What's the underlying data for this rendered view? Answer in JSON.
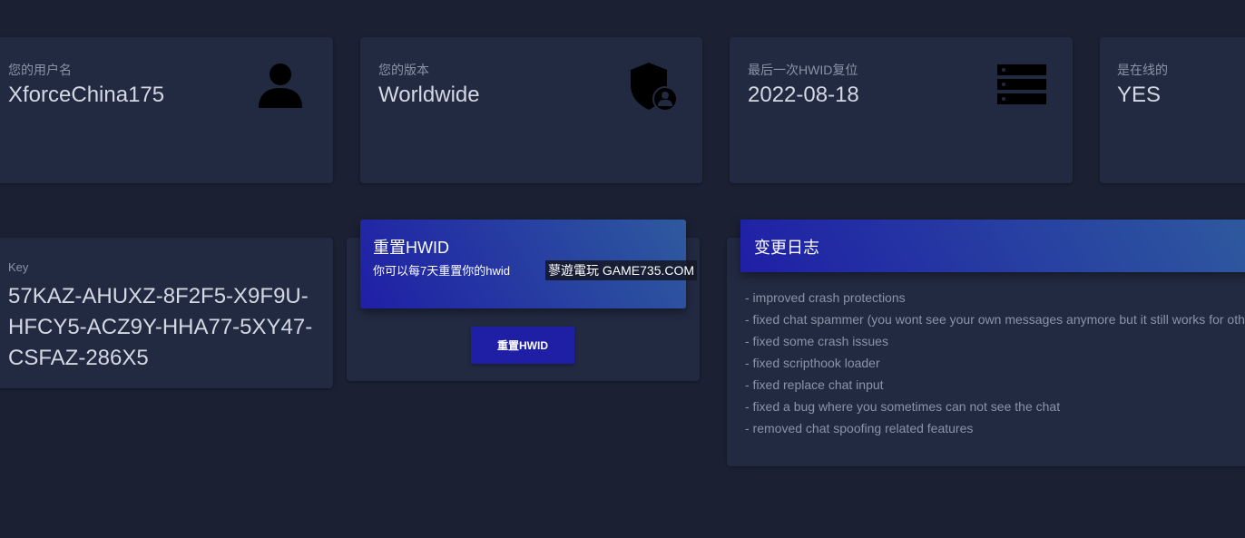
{
  "stats": [
    {
      "label": "您的用户名",
      "value": "XforceChina175",
      "icon": "user-icon"
    },
    {
      "label": "您的版本",
      "value": "Worldwide",
      "icon": "shield-user-icon"
    },
    {
      "label": "最后一次HWID复位",
      "value": "2022-08-18",
      "icon": "server-icon"
    },
    {
      "label": "是在线的",
      "value": "YES"
    }
  ],
  "key": {
    "label": "Key",
    "value": "57KAZ-AHUXZ-8F2F5-X9F9U-HFCY5-ACZ9Y-HHA77-5XY47-CSFAZ-286X5"
  },
  "hwid_reset": {
    "title": "重置HWID",
    "subtitle": "你可以每7天重置你的hwid",
    "button_label": "重置HWID"
  },
  "watermark": "蓼遊電玩 GAME735.COM",
  "changelog": {
    "title": "变更日志",
    "items": [
      "- improved crash protections",
      "- fixed chat spammer (you wont see your own messages anymore but it still works for others)",
      "- fixed some crash issues",
      "- fixed scripthook loader",
      "- fixed replace chat input",
      "- fixed a bug where you sometimes can not see the chat",
      "- removed chat spoofing related features"
    ]
  },
  "colors": {
    "background": "#1b2033",
    "card": "#222a42",
    "accent": "#1f1fa6"
  }
}
